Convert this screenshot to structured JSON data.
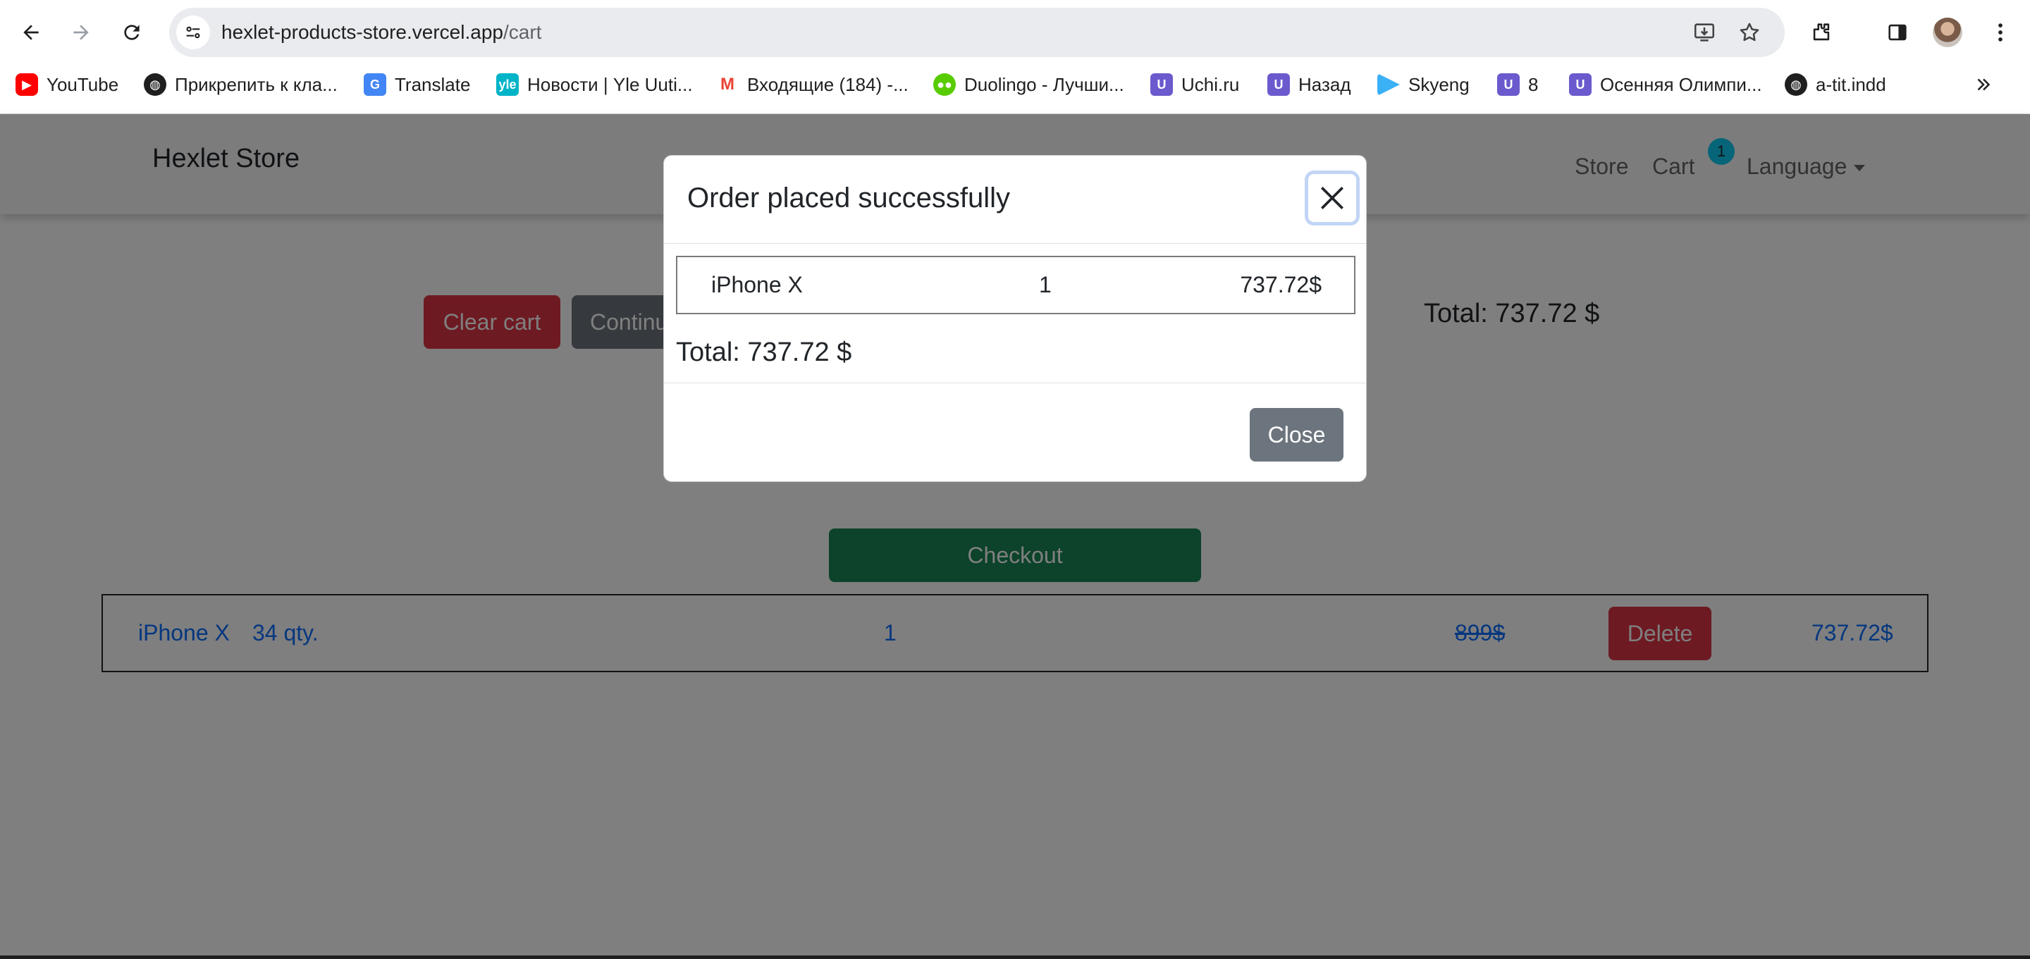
{
  "browser": {
    "url_host": "hexlet-products-store.vercel.app",
    "url_path": "/cart",
    "bookmarks": [
      {
        "label": "YouTube",
        "icon": "youtube-icon",
        "color": "#ff0000"
      },
      {
        "label": "Прикрепить к кла...",
        "icon": "globe-icon",
        "color": "#1f1f1f"
      },
      {
        "label": "Translate",
        "icon": "google-translate-icon",
        "color": "#4285f4"
      },
      {
        "label": "Новости | Yle Uuti...",
        "icon": "yle-icon",
        "color": "#00b4c8"
      },
      {
        "label": "Входящие (184) -...",
        "icon": "gmail-icon",
        "color": "#ea4335"
      },
      {
        "label": "Duolingo - Лучши...",
        "icon": "duolingo-icon",
        "color": "#58cc02"
      },
      {
        "label": "Uchi.ru",
        "icon": "uchi-icon",
        "color": "#6a5acd"
      },
      {
        "label": "Назад",
        "icon": "uchi-icon",
        "color": "#6a5acd"
      },
      {
        "label": "Skyeng",
        "icon": "skyeng-icon",
        "color": "#3ab0f5"
      },
      {
        "label": "8",
        "icon": "uchi-icon",
        "color": "#6a5acd"
      },
      {
        "label": "Осенняя Олимпи...",
        "icon": "uchi-icon",
        "color": "#6a5acd"
      },
      {
        "label": "a-tit.indd",
        "icon": "globe-icon",
        "color": "#1f1f1f"
      }
    ]
  },
  "navbar": {
    "brand": "Hexlet Store",
    "store_label": "Store",
    "cart_label": "Cart",
    "cart_count": "1",
    "language_label": "Language"
  },
  "cart": {
    "clear_label": "Clear cart",
    "continue_label": "Continue shopping",
    "total_text": "Total: 737.72 $",
    "checkout_label": "Checkout",
    "items": [
      {
        "name": "iPhone X",
        "stock": "34 qty.",
        "quantity": "1",
        "old_price": "899$",
        "delete_label": "Delete",
        "price": "737.72$"
      }
    ]
  },
  "modal": {
    "title": "Order placed successfully",
    "order_rows": [
      {
        "name": "iPhone X",
        "quantity": "1",
        "price": "737.72$"
      }
    ],
    "total_text": "Total: 737.72 $",
    "close_label": "Close"
  },
  "colors": {
    "danger": "#dc3545",
    "secondary": "#6c757d",
    "success": "#198754",
    "link": "#0d6efd",
    "badge": "#0dcaf0"
  }
}
